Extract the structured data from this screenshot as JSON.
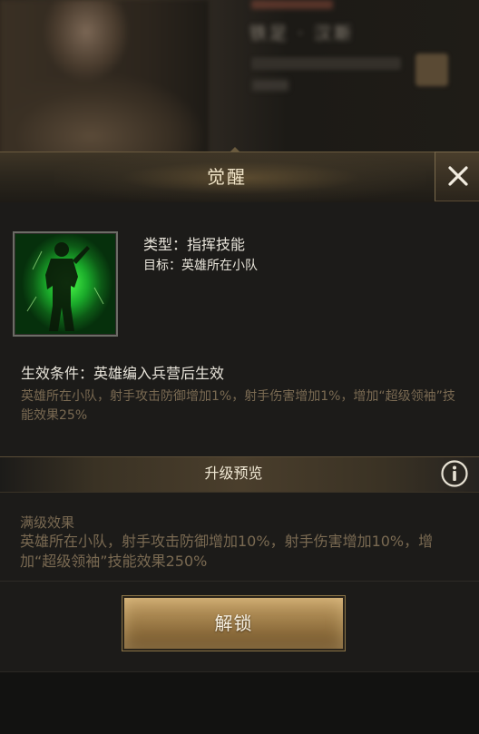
{
  "background": {
    "blurred_name": "铁足 · 汉斯"
  },
  "dialog": {
    "title": "觉醒",
    "close_icon": "close-icon"
  },
  "skill": {
    "icon": "soldier-silhouette-icon",
    "type": "类型：指挥技能",
    "target": "目标：英雄所在小队",
    "condition": "生效条件：英雄编入兵营后生效",
    "description": "英雄所在小队，射手攻击防御增加1%，射手伤害增加1%，增加“超级领袖”技能效果25%"
  },
  "upgrade_preview": {
    "title": "升级预览",
    "info_icon": "info-icon",
    "max_level_title": "满级效果",
    "max_level_description": "英雄所在小队，射手攻击防御增加10%，射手伤害增加10%，增加“超级领袖”技能效果250%"
  },
  "actions": {
    "unlock_label": "解锁"
  },
  "colors": {
    "accent_gold": "#a88650",
    "muted_text": "#7a6a52",
    "skill_glow": "#4cff4a"
  }
}
